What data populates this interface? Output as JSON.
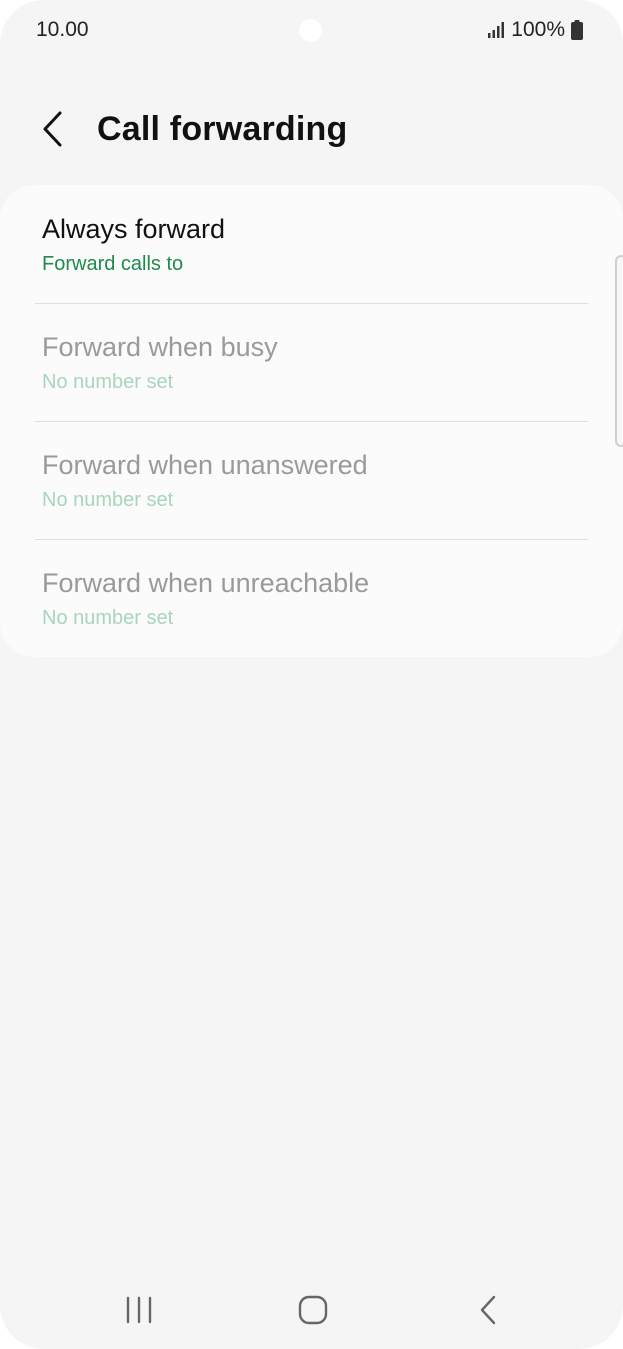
{
  "status_bar": {
    "time": "10.00",
    "battery": "100%",
    "icons": [
      "signal-icon",
      "battery-icon"
    ]
  },
  "header": {
    "back_icon": "chevron-left-icon",
    "title": "Call forwarding"
  },
  "items": [
    {
      "title": "Always forward",
      "subtitle": "Forward calls to",
      "enabled": true
    },
    {
      "title": "Forward when busy",
      "subtitle": "No number set",
      "enabled": false
    },
    {
      "title": "Forward when unanswered",
      "subtitle": "No number set",
      "enabled": false
    },
    {
      "title": "Forward when unreachable",
      "subtitle": "No number set",
      "enabled": false
    }
  ],
  "nav_bar": {
    "icons": [
      "recent-apps-icon",
      "home-icon",
      "back-icon"
    ]
  },
  "colors": {
    "accent_green": "#1f8a4c",
    "disabled_green": "#a8d5bc",
    "background": "#f5f5f5"
  }
}
